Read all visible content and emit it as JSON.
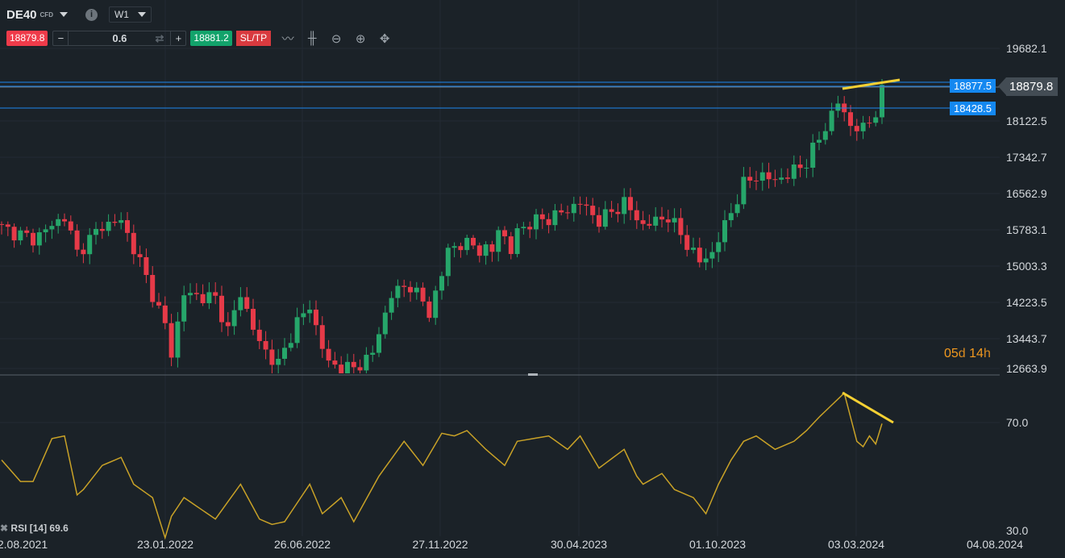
{
  "header": {
    "symbol": "DE40",
    "type": "CFD",
    "timeframe": "W1"
  },
  "trade": {
    "sell_price": "18879.8",
    "quantity": "0.6",
    "buy_price": "18881.2",
    "sltp_label": "SL/TP",
    "minus": "−",
    "plus": "+"
  },
  "tools": [
    "line-chart-icon",
    "candlestick-icon",
    "zoom-out-icon",
    "zoom-in-icon",
    "move-icon"
  ],
  "colors": {
    "bull": "#26a66a",
    "bear": "#e63a48",
    "level": "#1e88f0",
    "trend": "#f5d033",
    "rsi": "#c9a227",
    "bg": "#1b2228"
  },
  "timer": {
    "days": "05",
    "d": "d",
    "hours": "14",
    "h": "h"
  },
  "rsi_label": "RSI [14] 69.6",
  "chart_data": {
    "type": "candlestick",
    "interval": "weekly",
    "ylim": [
      12663.9,
      19682.1
    ],
    "y_ticks": [
      "19682.1",
      "18122.5",
      "17342.7",
      "16562.9",
      "15783.1",
      "15003.3",
      "14223.5",
      "13443.7",
      "12663.9"
    ],
    "x_ticks": [
      "2.08.2021",
      "23.01.2022",
      "26.06.2022",
      "27.11.2022",
      "30.04.2023",
      "01.10.2023",
      "03.03.2024",
      "04.08.2024"
    ],
    "close_keypoints": [
      [
        0,
        15750
      ],
      [
        5,
        15500
      ],
      [
        10,
        16000
      ],
      [
        12,
        15200
      ],
      [
        16,
        15800
      ],
      [
        19,
        15900
      ],
      [
        22,
        15000
      ],
      [
        26,
        13600
      ],
      [
        27,
        13000
      ],
      [
        29,
        14300
      ],
      [
        34,
        14200
      ],
      [
        36,
        13500
      ],
      [
        38,
        14300
      ],
      [
        41,
        13200
      ],
      [
        44,
        12750
      ],
      [
        47,
        13700
      ],
      [
        49,
        14000
      ],
      [
        52,
        12750
      ],
      [
        56,
        12650
      ],
      [
        59,
        13000
      ],
      [
        62,
        14300
      ],
      [
        65,
        14500
      ],
      [
        68,
        13900
      ],
      [
        70,
        14700
      ],
      [
        71,
        15300
      ],
      [
        74,
        15400
      ],
      [
        78,
        15200
      ],
      [
        79,
        15800
      ],
      [
        81,
        15200
      ],
      [
        82,
        15700
      ],
      [
        85,
        15900
      ],
      [
        88,
        16000
      ],
      [
        92,
        16300
      ],
      [
        95,
        15900
      ],
      [
        99,
        16300
      ],
      [
        102,
        15800
      ],
      [
        106,
        16000
      ],
      [
        109,
        15400
      ],
      [
        111,
        15000
      ],
      [
        113,
        15200
      ],
      [
        115,
        15800
      ],
      [
        118,
        16700
      ],
      [
        120,
        16900
      ],
      [
        123,
        16800
      ],
      [
        125,
        16900
      ],
      [
        128,
        17200
      ],
      [
        130,
        17700
      ],
      [
        133,
        18500
      ],
      [
        135,
        18000
      ],
      [
        137,
        17900
      ],
      [
        139,
        18300
      ],
      [
        140,
        18880
      ]
    ],
    "levels": [
      "18877.5",
      "18428.5"
    ],
    "current_price": "18879.8",
    "rsi": {
      "period": 14,
      "ylim": [
        30,
        70
      ],
      "ticks": [
        "70.0",
        "30.0"
      ],
      "keypoints": [
        [
          0,
          56
        ],
        [
          3,
          48
        ],
        [
          5,
          48
        ],
        [
          8,
          64
        ],
        [
          10,
          65
        ],
        [
          12,
          43
        ],
        [
          13,
          45
        ],
        [
          16,
          54
        ],
        [
          19,
          57
        ],
        [
          21,
          47
        ],
        [
          24,
          42
        ],
        [
          26,
          27
        ],
        [
          27,
          35
        ],
        [
          29,
          42
        ],
        [
          34,
          34
        ],
        [
          38,
          47
        ],
        [
          41,
          34
        ],
        [
          43,
          32
        ],
        [
          45,
          33
        ],
        [
          49,
          47
        ],
        [
          51,
          36
        ],
        [
          54,
          42
        ],
        [
          56,
          33
        ],
        [
          60,
          50
        ],
        [
          64,
          63
        ],
        [
          67,
          54
        ],
        [
          70,
          66
        ],
        [
          72,
          65
        ],
        [
          74,
          67
        ],
        [
          77,
          60
        ],
        [
          80,
          54
        ],
        [
          82,
          63
        ],
        [
          87,
          65
        ],
        [
          90,
          60
        ],
        [
          92,
          65
        ],
        [
          95,
          53
        ],
        [
          99,
          60
        ],
        [
          101,
          50
        ],
        [
          102,
          47
        ],
        [
          105,
          51
        ],
        [
          107,
          45
        ],
        [
          110,
          42
        ],
        [
          112,
          36
        ],
        [
          114,
          47
        ],
        [
          116,
          56
        ],
        [
          118,
          63
        ],
        [
          120,
          65
        ],
        [
          123,
          60
        ],
        [
          126,
          63
        ],
        [
          128,
          67
        ],
        [
          130,
          72
        ],
        [
          134,
          81
        ],
        [
          136,
          63
        ],
        [
          137,
          61
        ],
        [
          138,
          65
        ],
        [
          139,
          62
        ],
        [
          140,
          69.6
        ]
      ]
    }
  }
}
